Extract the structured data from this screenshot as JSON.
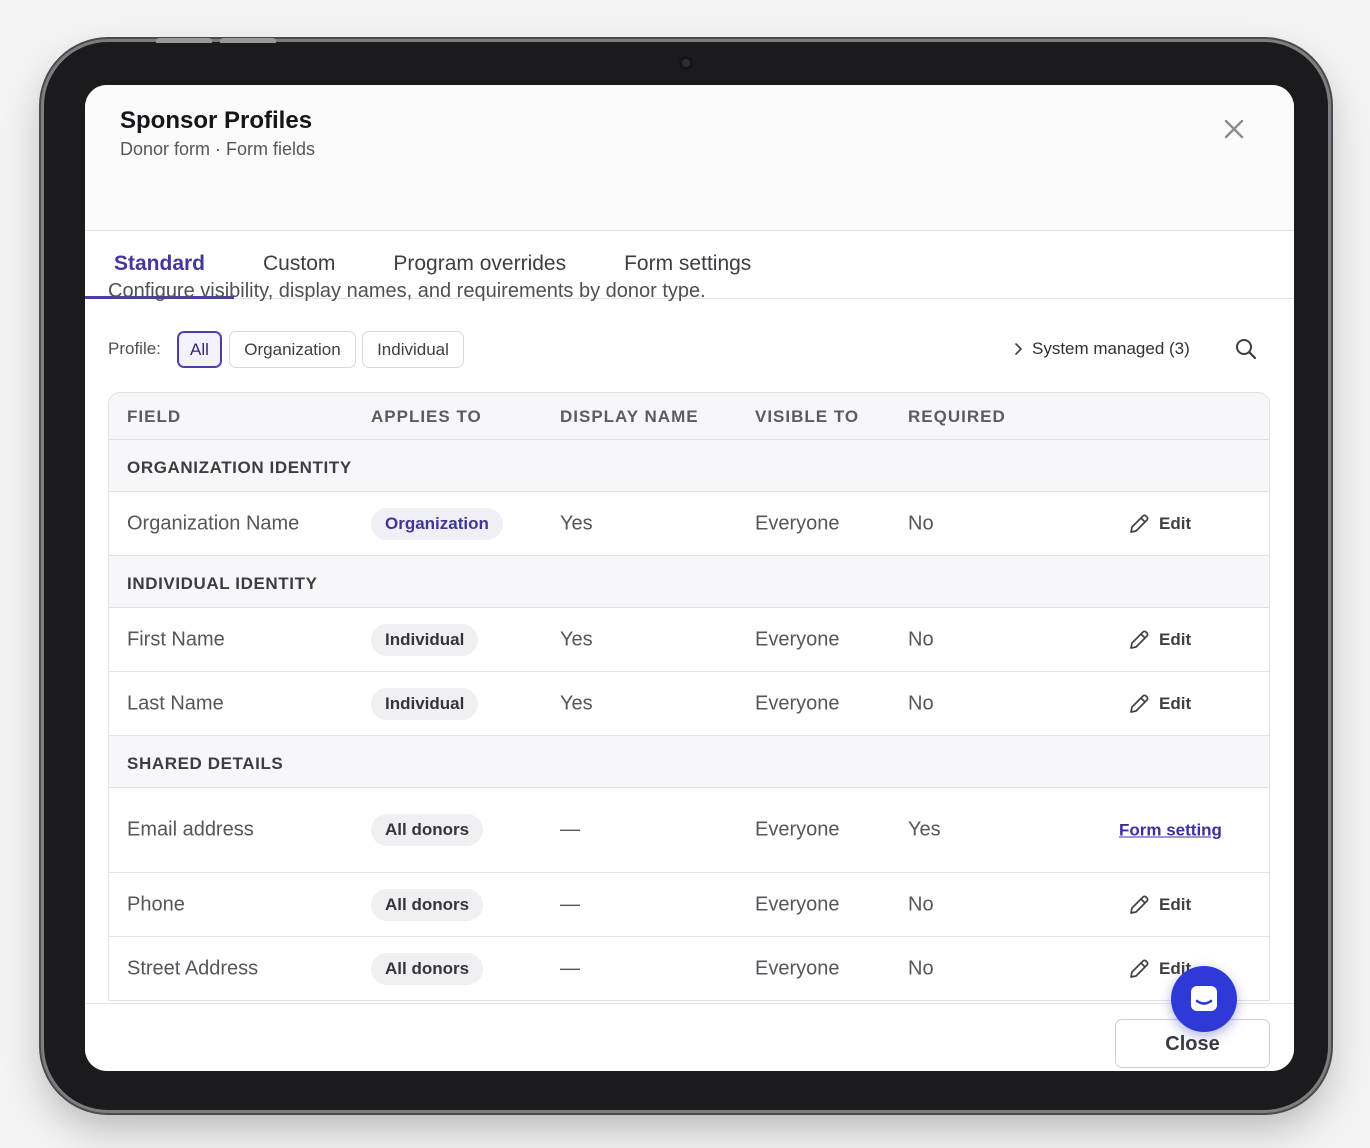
{
  "header": {
    "title": "Sponsor Profiles",
    "subtitle": "Donor form · Form fields"
  },
  "tabs": [
    {
      "label": "Standard",
      "active": true
    },
    {
      "label": "Custom",
      "active": false
    },
    {
      "label": "Program overrides",
      "active": false
    },
    {
      "label": "Form settings",
      "active": false
    }
  ],
  "description": "Configure visibility, display names, and requirements by donor type.",
  "filters": {
    "label": "Profile:",
    "options": [
      {
        "label": "All",
        "active": true
      },
      {
        "label": "Organization",
        "active": false
      },
      {
        "label": "Individual",
        "active": false
      }
    ],
    "system_managed": "System managed (3)"
  },
  "table": {
    "columns": [
      "FIELD",
      "APPLIES TO",
      "DISPLAY NAME",
      "VISIBLE TO",
      "REQUIRED"
    ],
    "groups": [
      {
        "name": "ORGANIZATION IDENTITY",
        "rows": [
          {
            "field": "Organization Name",
            "applies": "Organization",
            "display": "Yes",
            "visible": "Everyone",
            "required": "No",
            "action": "Edit"
          }
        ]
      },
      {
        "name": "INDIVIDUAL IDENTITY",
        "rows": [
          {
            "field": "First Name",
            "applies": "Individual",
            "display": "Yes",
            "visible": "Everyone",
            "required": "No",
            "action": "Edit"
          },
          {
            "field": "Last Name",
            "applies": "Individual",
            "display": "Yes",
            "visible": "Everyone",
            "required": "No",
            "action": "Edit"
          }
        ]
      },
      {
        "name": "SHARED DETAILS",
        "rows": [
          {
            "field": "Email address",
            "applies": "All donors",
            "display": "—",
            "visible": "Everyone",
            "required": "Yes",
            "action": "Form setting"
          },
          {
            "field": "Phone",
            "applies": "All donors",
            "display": "—",
            "visible": "Everyone",
            "required": "No",
            "action": "Edit"
          },
          {
            "field": "Street Address",
            "applies": "All donors",
            "display": "—",
            "visible": "Everyone",
            "required": "No",
            "action": "Edit"
          }
        ]
      }
    ]
  },
  "footer": {
    "close_label": "Close"
  },
  "colors": {
    "accent": "#4a3fa8",
    "chat_fab": "#2f39d8"
  }
}
